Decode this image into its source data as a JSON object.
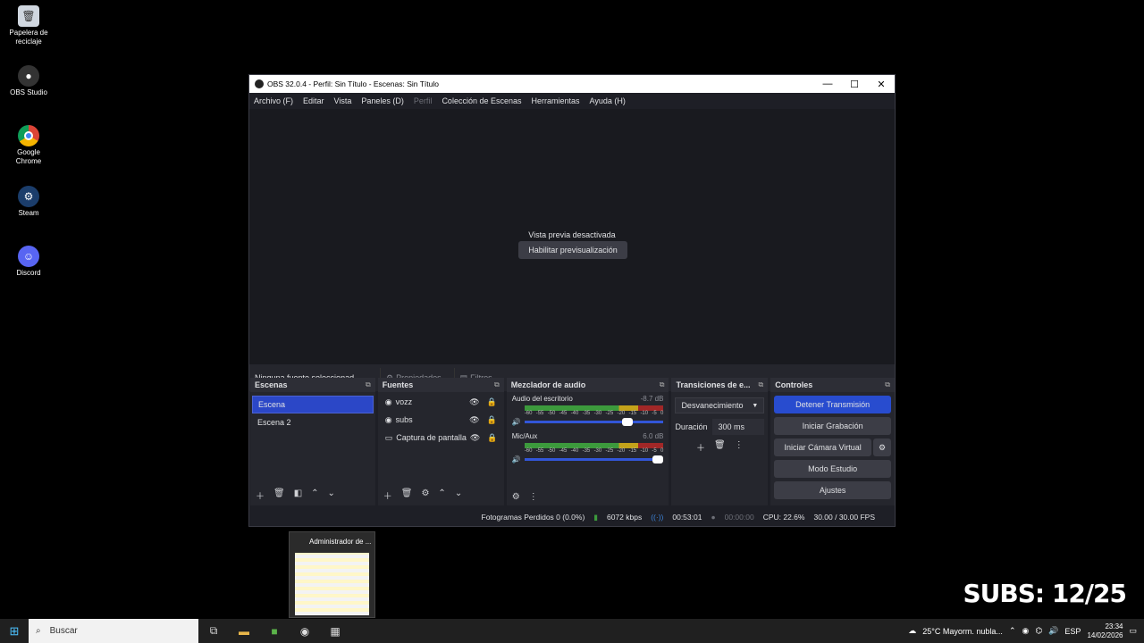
{
  "desktop": {
    "icons": [
      {
        "label": "Papelera de reciclaje",
        "icon": "recycle-bin-icon"
      },
      {
        "label": "OBS Studio",
        "icon": "obs-icon"
      },
      {
        "label": "Google Chrome",
        "icon": "chrome-icon"
      },
      {
        "label": "Steam",
        "icon": "steam-icon"
      },
      {
        "label": "Discord",
        "icon": "discord-icon"
      }
    ],
    "overlay_text": "SUBS: 12/25"
  },
  "window": {
    "title": "OBS 32.0.4 - Perfil: Sin Título - Escenas: Sin Título",
    "controls": [
      "—",
      "☐",
      "✕"
    ]
  },
  "menu": [
    "Archivo (F)",
    "Editar",
    "Vista",
    "Paneles (D)",
    "Perfil",
    "Colección de Escenas",
    "Herramientas",
    "Ayuda (H)"
  ],
  "preview": {
    "message": "Vista previa desactivada",
    "enable_button": "Habilitar previsualización"
  },
  "source_bar": {
    "label": "Ninguna fuente seleccionad",
    "properties": "Propiedades",
    "filters": "Filtros"
  },
  "scenes": {
    "title": "Escenas",
    "items": [
      "Escena",
      "Escena 2"
    ],
    "selected": 0
  },
  "sources": {
    "title": "Fuentes",
    "items": [
      "vozz",
      "subs",
      "Captura de pantalla"
    ]
  },
  "mixer": {
    "title": "Mezclador de audio",
    "tracks": [
      {
        "name": "Audio del escritorio",
        "db": "-8.7 dB",
        "level": 0.78
      },
      {
        "name": "Mic/Aux",
        "db": "6.0 dB",
        "level": 1.0
      }
    ],
    "ticks": [
      "-60",
      "-55",
      "-50",
      "-45",
      "-40",
      "-35",
      "-30",
      "-25",
      "-20",
      "-15",
      "-10",
      "-5",
      "0"
    ]
  },
  "transitions": {
    "title": "Transiciones de e...",
    "selected": "Desvanecimiento",
    "duration_label": "Duración",
    "duration_value": "300 ms"
  },
  "controls": {
    "title": "Controles",
    "stop_stream": "Detener Transmisión",
    "start_recording": "Iniciar Grabación",
    "virtual_cam": "Iniciar Cámara Virtual",
    "studio_mode": "Modo Estudio",
    "settings": "Ajustes"
  },
  "status": {
    "dropped": "Fotogramas Perdidos 0 (0.0%)",
    "bitrate": "6072 kbps",
    "stream_time": "00:53:01",
    "rec_time": "00:00:00",
    "cpu": "CPU: 22.6%",
    "fps": "30.00 / 30.00 FPS"
  },
  "thumbnail": {
    "title": "Administrador de ..."
  },
  "taskbar": {
    "search_placeholder": "Buscar",
    "weather": "25°C  Mayorm. nubla...",
    "lang": "ESP",
    "time": "23:34",
    "date": "14/02/2026"
  }
}
